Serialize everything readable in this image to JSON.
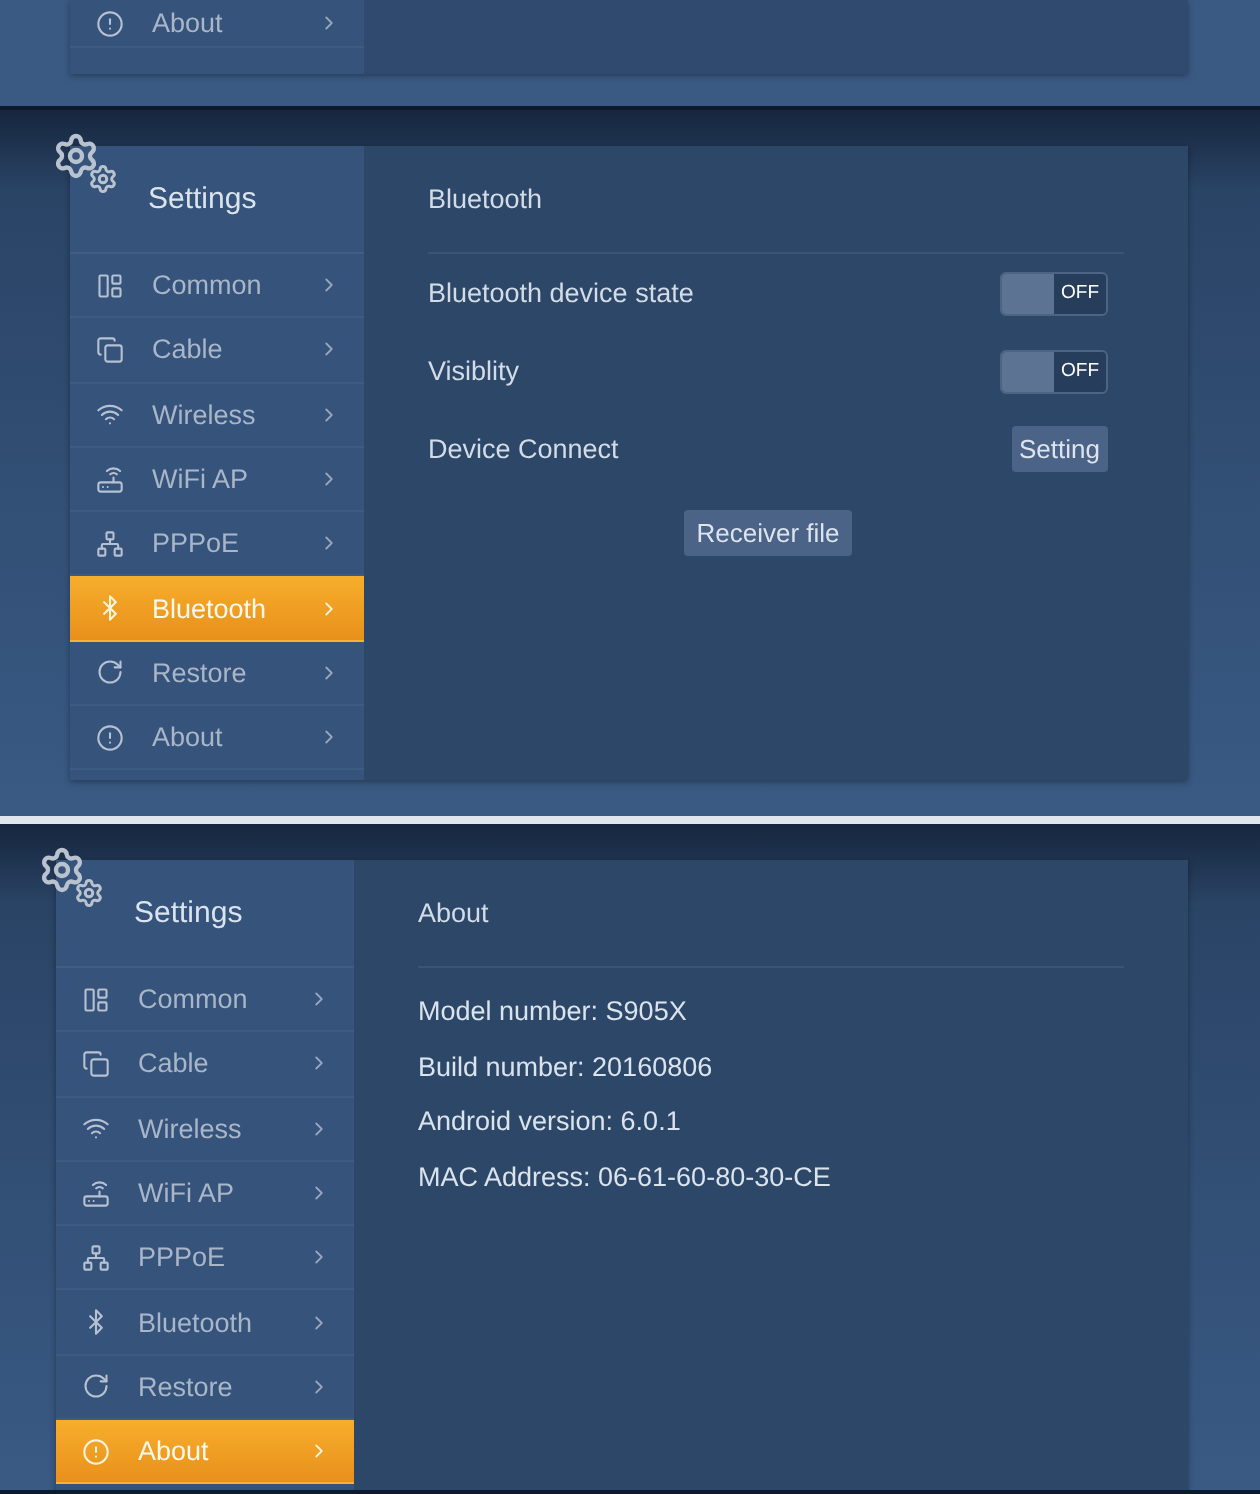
{
  "screens": [
    {
      "kind": "fragment",
      "sidebar": {
        "items": [
          {
            "label": "About",
            "kind": "about",
            "selected": false
          }
        ]
      }
    },
    {
      "kind": "settings",
      "sidebar": {
        "title": "Settings",
        "items": [
          {
            "label": "Common",
            "kind": "common",
            "selected": false
          },
          {
            "label": "Cable",
            "kind": "cable",
            "selected": false
          },
          {
            "label": "Wireless",
            "kind": "wireless",
            "selected": false
          },
          {
            "label": "WiFi AP",
            "kind": "wifiap",
            "selected": false
          },
          {
            "label": "PPPoE",
            "kind": "pppoe",
            "selected": false
          },
          {
            "label": "Bluetooth",
            "kind": "bluetooth",
            "selected": true
          },
          {
            "label": "Restore",
            "kind": "restore",
            "selected": false
          },
          {
            "label": "About",
            "kind": "about",
            "selected": false
          }
        ]
      },
      "content": {
        "kind": "bluetooth",
        "title": "Bluetooth",
        "rows": [
          {
            "kind": "toggle",
            "label": "Bluetooth device state",
            "on": false,
            "state_text": "OFF"
          },
          {
            "kind": "toggle",
            "label": "Visiblity",
            "on": false,
            "state_text": "OFF"
          },
          {
            "kind": "button",
            "label": "Device Connect",
            "button": "Setting"
          }
        ],
        "action": "Receiver file"
      }
    },
    {
      "kind": "settings",
      "sidebar": {
        "title": "Settings",
        "items": [
          {
            "label": "Common",
            "kind": "common",
            "selected": false
          },
          {
            "label": "Cable",
            "kind": "cable",
            "selected": false
          },
          {
            "label": "Wireless",
            "kind": "wireless",
            "selected": false
          },
          {
            "label": "WiFi AP",
            "kind": "wifiap",
            "selected": false
          },
          {
            "label": "PPPoE",
            "kind": "pppoe",
            "selected": false
          },
          {
            "label": "Bluetooth",
            "kind": "bluetooth",
            "selected": false
          },
          {
            "label": "Restore",
            "kind": "restore",
            "selected": false
          },
          {
            "label": "About",
            "kind": "about",
            "selected": true
          }
        ]
      },
      "content": {
        "kind": "about",
        "title": "About",
        "lines": [
          "Model number: S905X",
          "Build number: 20160806",
          "Android version: 6.0.1",
          "MAC Address: 06-61-60-80-30-CE"
        ]
      }
    }
  ]
}
